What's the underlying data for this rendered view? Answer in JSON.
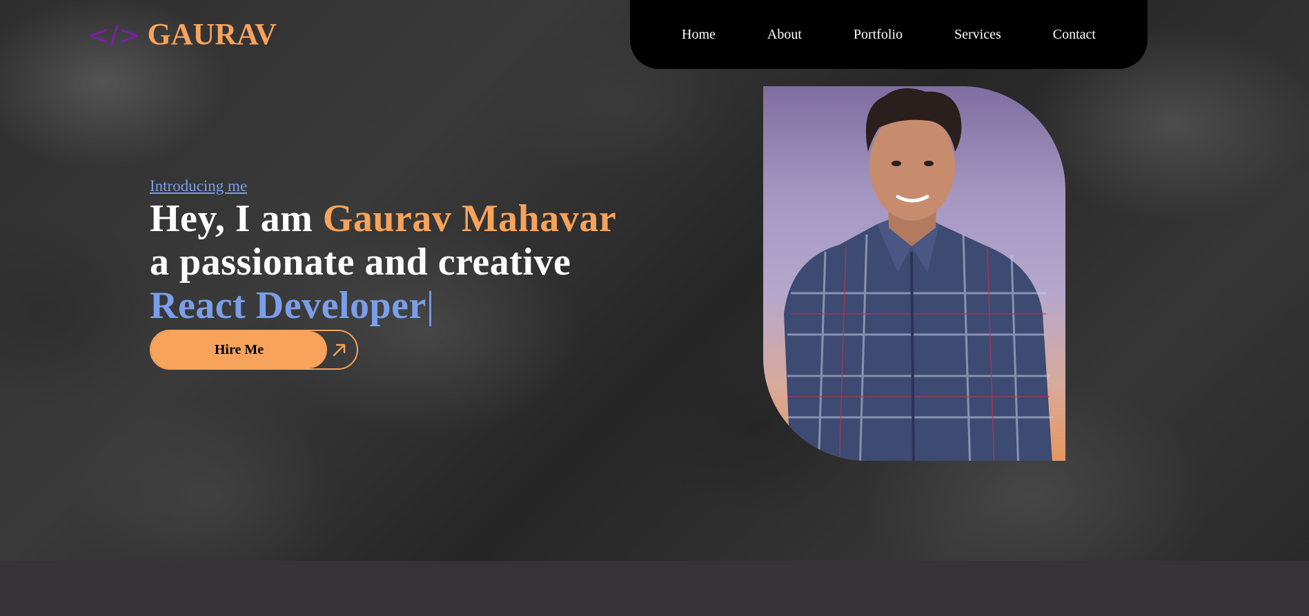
{
  "logo": {
    "icon": "</>",
    "icon_name": "code-brackets-icon",
    "text": "GAURAV",
    "icon_color": "#7a1fa8",
    "text_color": "#f7a35c"
  },
  "nav": {
    "items": [
      {
        "label": "Home"
      },
      {
        "label": "About"
      },
      {
        "label": "Portfolio"
      },
      {
        "label": "Services"
      },
      {
        "label": "Contact"
      }
    ]
  },
  "hero": {
    "intro": "Introducing me",
    "greeting": "Hey, I am ",
    "name": "Gaurav Mahavar",
    "line2": "a passionate and creative",
    "role": "React Developer",
    "cursor": "|",
    "hire_label": "Hire Me",
    "hire_icon": "arrow-up-right-icon"
  },
  "colors": {
    "accent_orange": "#f7a35c",
    "accent_blue": "#7b9ee8",
    "logo_purple": "#7a1fa8",
    "nav_bg": "#000000",
    "footer_bg": "#353335"
  }
}
